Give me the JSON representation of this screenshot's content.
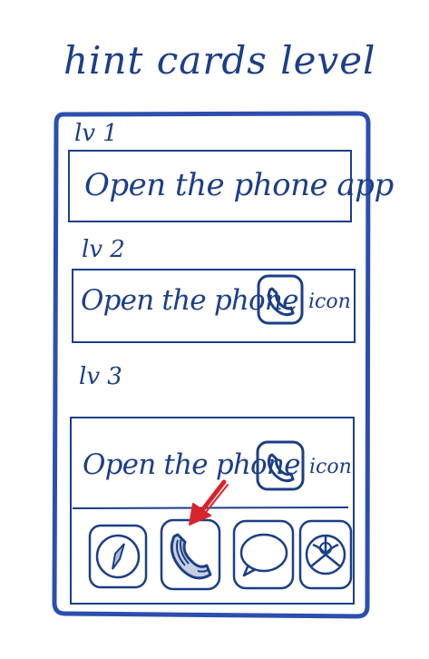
{
  "title": "hint cards level",
  "levels": [
    {
      "label": "lv 1",
      "text": "Open the phone app"
    },
    {
      "label": "lv 2",
      "text": "Open the phone",
      "suffix": "icon",
      "icon": "phone-icon"
    },
    {
      "label": "lv 3",
      "text": "Open the phone",
      "suffix": "icon",
      "icon": "phone-icon"
    }
  ],
  "dock_icons": [
    "compass-icon",
    "phone-icon",
    "chat-bubble-icon",
    "photos-icon"
  ],
  "highlighted_icon": "phone-icon",
  "colors": {
    "ink": "#1c3f86",
    "arrow": "#d8232a",
    "background": "#ffffff"
  }
}
